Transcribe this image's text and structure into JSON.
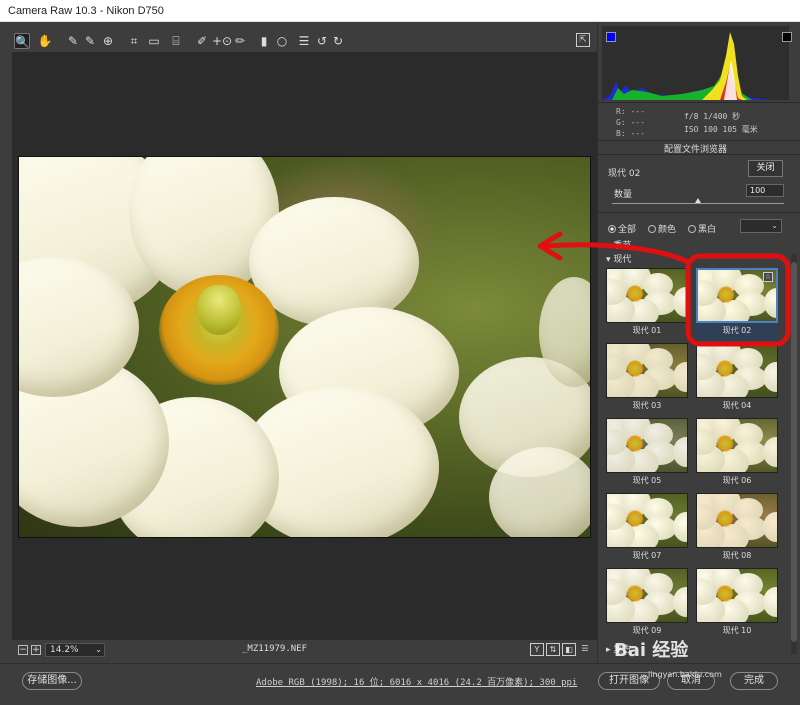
{
  "window": {
    "title": "Camera Raw 10.3 -  Nikon D750"
  },
  "toolbar": {
    "tools": [
      {
        "name": "zoom-tool",
        "glyph": "🔍"
      },
      {
        "name": "hand-tool",
        "glyph": "✋"
      },
      {
        "name": "white-balance-tool",
        "glyph": "✎"
      },
      {
        "name": "color-sampler-tool",
        "glyph": "✎"
      },
      {
        "name": "targeted-adjustment-tool",
        "glyph": "⊕"
      },
      {
        "name": "crop-tool",
        "glyph": "⌗"
      },
      {
        "name": "straighten-tool",
        "glyph": "▭"
      },
      {
        "name": "transform-tool",
        "glyph": "⌸"
      },
      {
        "name": "spot-removal-tool",
        "glyph": "✐"
      },
      {
        "name": "red-eye-tool",
        "glyph": "+⊙"
      },
      {
        "name": "adjustment-brush-tool",
        "glyph": "✏"
      },
      {
        "name": "graduated-filter-tool",
        "glyph": "▮"
      },
      {
        "name": "radial-filter-tool",
        "glyph": "○"
      },
      {
        "name": "preferences-tool",
        "glyph": "☰"
      },
      {
        "name": "rotate-left-tool",
        "glyph": "↺"
      },
      {
        "name": "rotate-right-tool",
        "glyph": "↻"
      }
    ],
    "fullscreen_glyph": "⇱"
  },
  "preview": {
    "zoom_value": "14.2%",
    "filename": "_MZ11979.NEF",
    "view_buttons": [
      "Y",
      "⇅",
      "◧",
      "☰"
    ]
  },
  "footer": {
    "save_label": "存储图像...",
    "info": "Adobe RGB (1998); 16 位; 6016 x 4016 (24.2 百万像素); 300 ppi",
    "open_label": "打开图像",
    "cancel_label": "取消",
    "done_label": "完成"
  },
  "readout": {
    "r": "R:   ---",
    "g": "G:   ---",
    "b": "B:   ---",
    "aperture_shutter": "f/8   1/400 秒",
    "iso_focal": "ISO 100   105 毫米"
  },
  "profile_browser": {
    "title": "配置文件浏览器",
    "current_profile": "现代 02",
    "close_label": "关闭",
    "amount_label": "数量",
    "amount_value": "100",
    "amount_fraction": 0.5,
    "filters": [
      "全部",
      "颜色",
      "黑白"
    ],
    "selected_filter": "全部",
    "group_collapsed": "▸ 季节",
    "group_open": "▾ 现代",
    "profiles": [
      "现代 01",
      "现代 02",
      "现代 03",
      "现代 04",
      "现代 05",
      "现代 06",
      "现代 07",
      "现代 08",
      "现代 09",
      "现代 10"
    ],
    "selected_profile": "现代 02",
    "next_group": "▸ 复古"
  },
  "watermark": {
    "text": "Bai 经验",
    "url": "jingyan.baidu.com"
  },
  "colors": {
    "panel_bg": "#3d3d3d",
    "preview_bg": "#2b2b2b",
    "selection_blue": "#4a80c6",
    "annotation_red": "#e01010"
  }
}
